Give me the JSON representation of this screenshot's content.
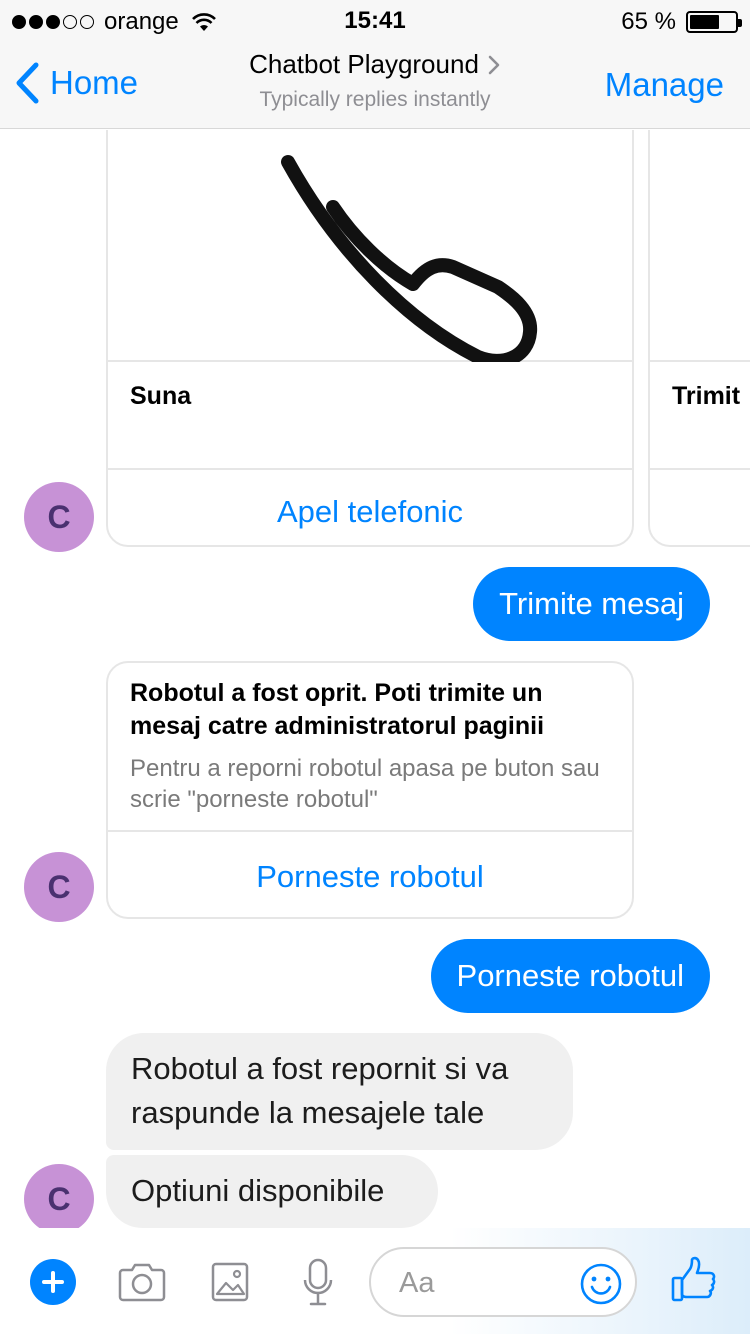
{
  "status_bar": {
    "carrier": "orange",
    "time": "15:41",
    "battery": "65 %",
    "battery_level": 0.65,
    "signal_bars_filled": 3,
    "signal_bars_total": 5
  },
  "nav": {
    "back_label": "Home",
    "title": "Chatbot Playground",
    "subtitle": "Typically replies instantly",
    "manage_label": "Manage"
  },
  "messages": {
    "carousel": {
      "card1_title": "Suna",
      "card1_button": "Apel telefonic",
      "card2_title": "Trimit"
    },
    "out1": "Trimite mesaj",
    "robot_card": {
      "title": "Robotul a fost oprit. Poti trimite un mesaj catre administratorul paginii",
      "subtitle": "Pentru a reporni robotul apasa pe buton sau scrie \"porneste robotul\"",
      "button": "Porneste robotul"
    },
    "out2": "Porneste robotul",
    "in1_line1": "Robotul a fost repornit si va",
    "in1_line2": "raspunde la mesajele tale",
    "in2": "Optiuni disponibile",
    "avatar_letter": "C"
  },
  "composer": {
    "placeholder": "Aa"
  },
  "colors": {
    "accent": "#0084ff",
    "avatar_bg": "#c792d6",
    "incoming_bubble": "#f0f0f0"
  },
  "icons": {
    "back": "chevron-left-icon",
    "plus": "plus-icon",
    "camera": "camera-icon",
    "gallery": "image-icon",
    "mic": "microphone-icon",
    "emoji": "smiley-icon",
    "like": "thumbs-up-icon"
  }
}
